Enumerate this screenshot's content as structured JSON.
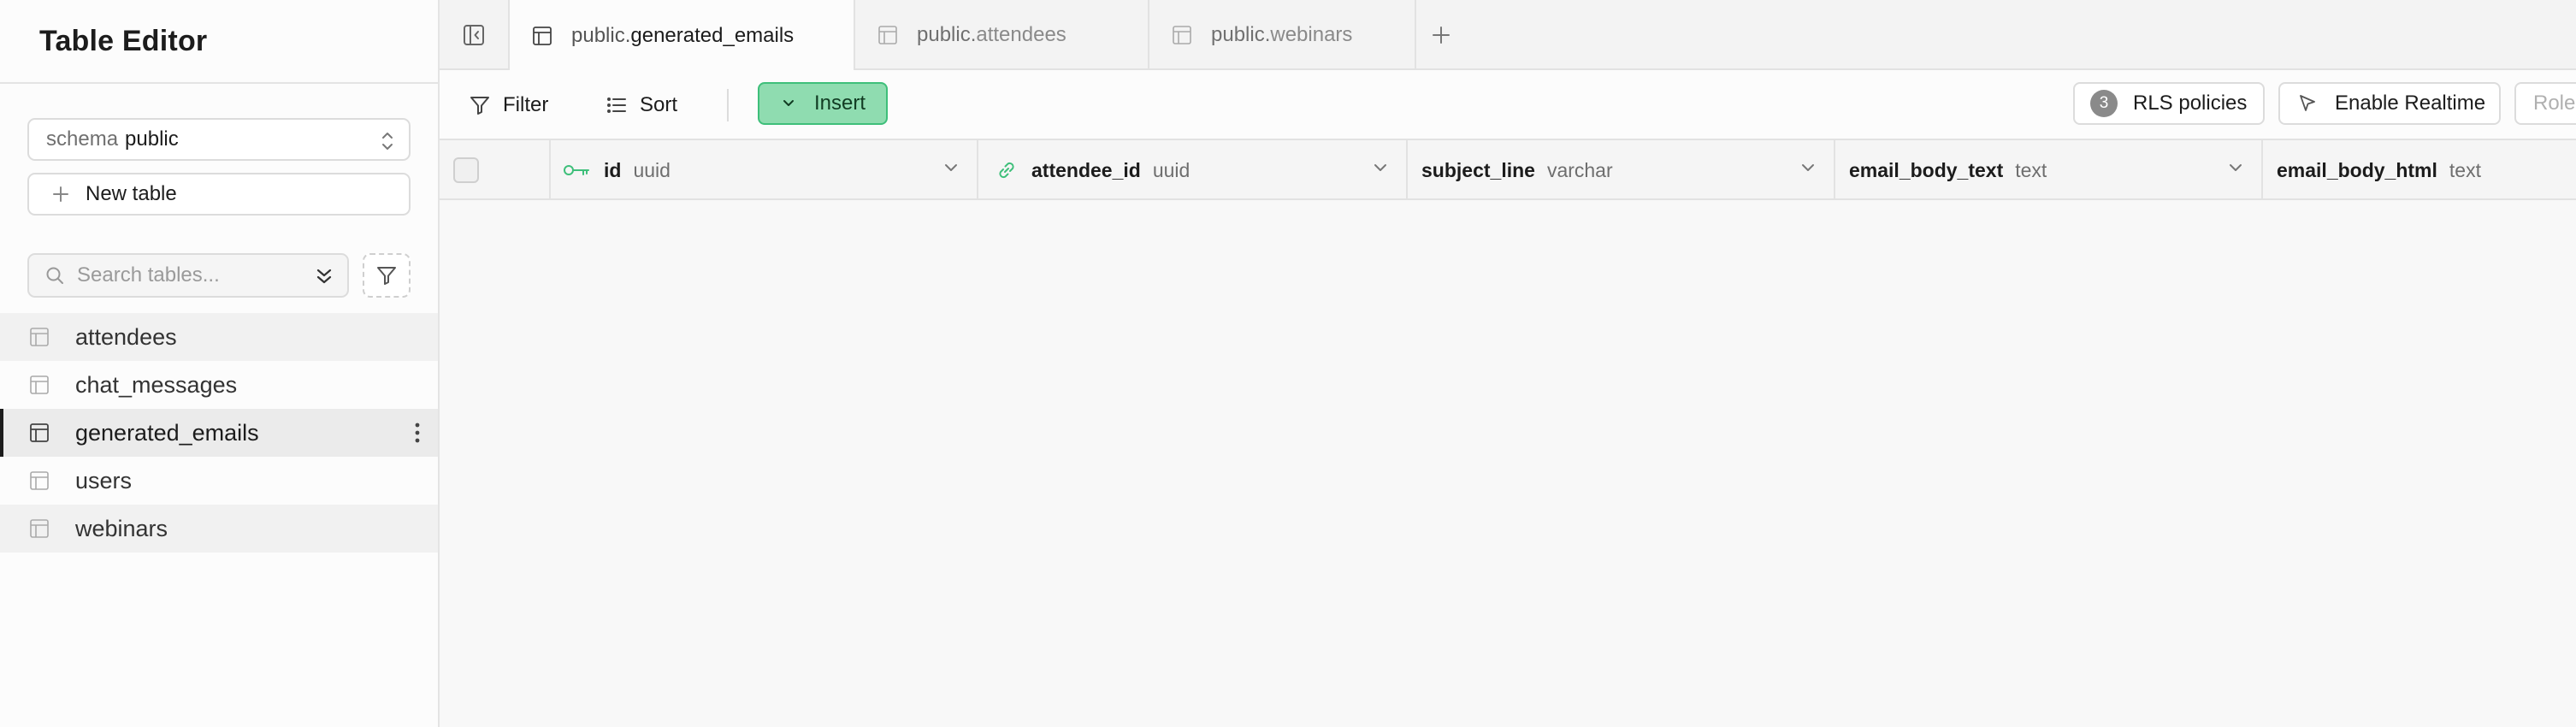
{
  "sidebar": {
    "title": "Table Editor",
    "schema": {
      "label": "schema",
      "value": "public"
    },
    "new_table_label": "New table",
    "search_placeholder": "Search tables...",
    "tables": [
      {
        "name": "attendees"
      },
      {
        "name": "chat_messages"
      },
      {
        "name": "generated_emails",
        "active": true
      },
      {
        "name": "users"
      },
      {
        "name": "webinars"
      }
    ]
  },
  "tabs": [
    {
      "prefix": "public.",
      "name": "generated_emails",
      "active": true
    },
    {
      "prefix": "public.",
      "name": "attendees"
    },
    {
      "prefix": "public.",
      "name": "webinars",
      "italic": true
    }
  ],
  "toolbar": {
    "filter_label": "Filter",
    "sort_label": "Sort",
    "insert_label": "Insert",
    "rls_count": "3",
    "rls_label": "RLS policies",
    "realtime_label": "Enable Realtime",
    "role_label": "Role"
  },
  "columns": [
    {
      "name": "id",
      "type": "uuid",
      "icon": "key-icon"
    },
    {
      "name": "attendee_id",
      "type": "uuid",
      "icon": "link-icon"
    },
    {
      "name": "subject_line",
      "type": "varchar"
    },
    {
      "name": "email_body_text",
      "type": "text"
    },
    {
      "name": "email_body_html",
      "type": "text"
    }
  ],
  "colors": {
    "accent_green": "#3ebf7a",
    "insert_bg": "#8fdcb0"
  }
}
